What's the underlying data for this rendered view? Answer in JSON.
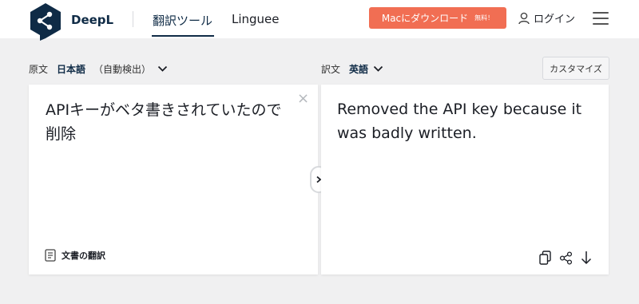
{
  "header": {
    "brand": "DeepL",
    "tabs": [
      {
        "label": "翻訳ツール",
        "active": true
      },
      {
        "label": "Linguee",
        "active": false
      }
    ],
    "download_button": {
      "label": "Macにダウンロード",
      "badge": "無料！"
    },
    "login_label": "ログイン"
  },
  "source": {
    "label": "原文",
    "language": "日本語",
    "detect": "（自動検出）",
    "text": "APIキーがベタ書きされていたので削除",
    "document_translate": "文書の翻訳"
  },
  "target": {
    "label": "訳文",
    "language": "英語",
    "text": "Removed the API key because it was badly written.",
    "customize_label": "カスタマイズ"
  },
  "colors": {
    "brand_navy": "#0f2b46",
    "download_orange": "#f16e53",
    "page_bg": "#f0f0f1"
  },
  "icons": [
    "deepl-logo-icon",
    "user-icon",
    "menu-icon",
    "chevron-down-icon",
    "close-icon",
    "document-icon",
    "swap-arrow-icon",
    "copy-icon",
    "share-icon",
    "download-icon"
  ]
}
